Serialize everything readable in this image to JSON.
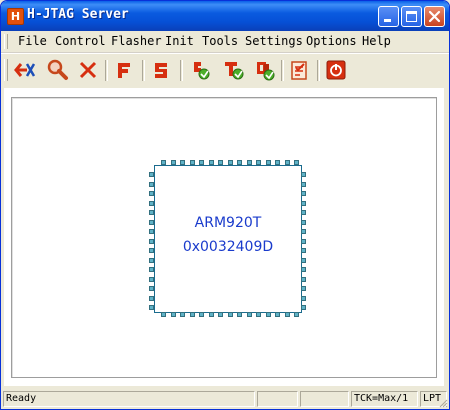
{
  "window": {
    "title": "H-JTAG Server",
    "app_icon_letter": "H"
  },
  "menu": [
    "File",
    "Control",
    "Flasher",
    "Init",
    "Tools",
    "Settings",
    "Options",
    "Help"
  ],
  "toolbar": {
    "icons": [
      "detect-target-icon",
      "search-icon",
      "stop-icon",
      "flasher-icon",
      "script-icon",
      "init-icon",
      "tools-icon",
      "settings-icon",
      "options-icon",
      "power-icon"
    ]
  },
  "device": {
    "core": "ARM920T",
    "id": "0x0032409D"
  },
  "status": {
    "text": "Ready",
    "tck": "TCK=Max/1",
    "port": "LPT"
  },
  "colors": {
    "titlebar": "#0a5be0",
    "chip_text": "#1a3bcc",
    "chip_pin": "#5fb2c7",
    "toolbar_icon": "#d62f10"
  }
}
